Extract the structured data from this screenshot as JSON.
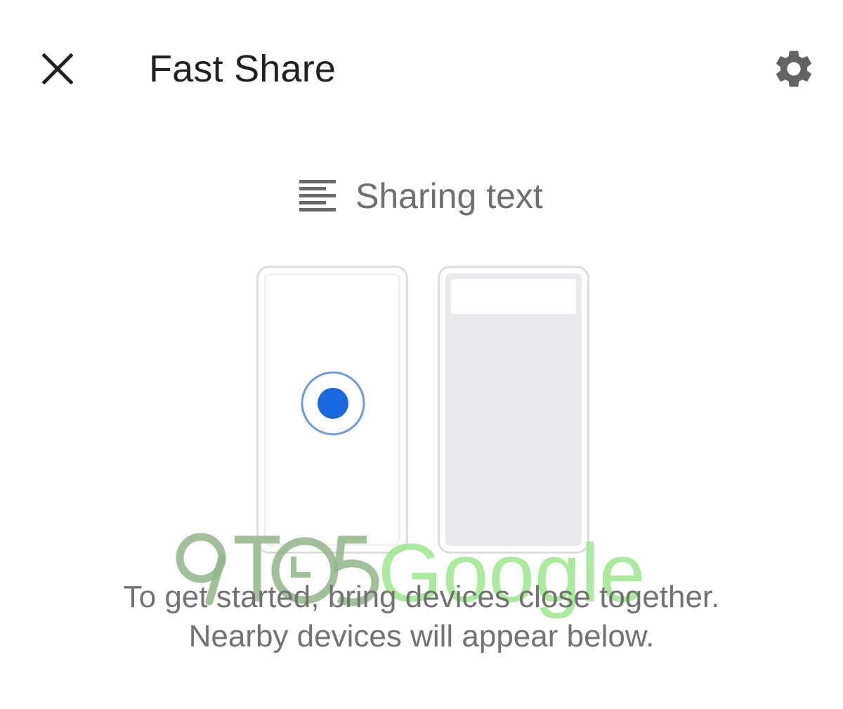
{
  "header": {
    "title": "Fast Share",
    "close_icon": "close-icon",
    "settings_icon": "gear-icon"
  },
  "sharing": {
    "icon": "text-lines-icon",
    "label": "Sharing text"
  },
  "illustration": {
    "sender_indicator_color": "#1a68e0",
    "receiver_screen_color": "#e9e8ec"
  },
  "instructions": {
    "line1": "To get started, bring devices close together.",
    "line2": "Nearby devices will appear below."
  },
  "watermark": {
    "text": "9TO5Google"
  },
  "colors": {
    "accent": "#1a68e0",
    "title": "#202124",
    "secondary_text": "#727272",
    "icon": "#636363"
  }
}
